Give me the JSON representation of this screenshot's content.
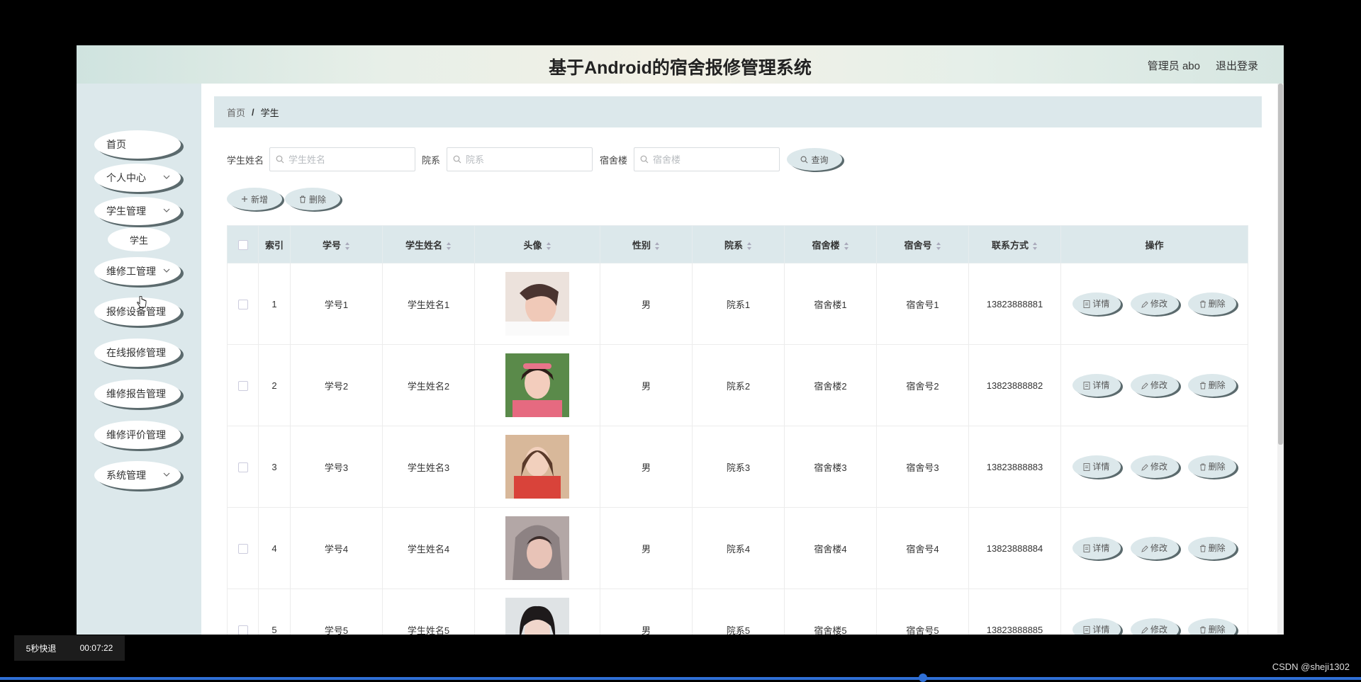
{
  "header": {
    "title": "基于Android的宿舍报修管理系统",
    "user": "管理员 abo",
    "logout": "退出登录"
  },
  "sidebar": {
    "items": [
      {
        "label": "首页"
      },
      {
        "label": "个人中心"
      },
      {
        "label": "学生管理"
      },
      {
        "label": "学生"
      },
      {
        "label": "维修工管理"
      },
      {
        "label": "报修设备管理"
      },
      {
        "label": "在线报修管理"
      },
      {
        "label": "维修报告管理"
      },
      {
        "label": "维修评价管理"
      },
      {
        "label": "系统管理"
      }
    ]
  },
  "breadcrumb": {
    "home": "首页",
    "separator": "/",
    "current": "学生"
  },
  "search": {
    "name_label": "学生姓名",
    "name_placeholder": "学生姓名",
    "dept_label": "院系",
    "dept_placeholder": "院系",
    "dorm_label": "宿舍楼",
    "dorm_placeholder": "宿舍楼",
    "query_button": "查询"
  },
  "toolbar": {
    "add": "新增",
    "delete": "删除"
  },
  "table": {
    "headers": [
      "索引",
      "学号",
      "学生姓名",
      "头像",
      "性别",
      "院系",
      "宿舍楼",
      "宿舍号",
      "联系方式",
      "操作"
    ],
    "rows": [
      {
        "index": "1",
        "id": "学号1",
        "name": "学生姓名1",
        "gender": "男",
        "dept": "院系1",
        "building": "宿舍楼1",
        "room": "宿舍号1",
        "phone": "13823888881"
      },
      {
        "index": "2",
        "id": "学号2",
        "name": "学生姓名2",
        "gender": "男",
        "dept": "院系2",
        "building": "宿舍楼2",
        "room": "宿舍号2",
        "phone": "13823888882"
      },
      {
        "index": "3",
        "id": "学号3",
        "name": "学生姓名3",
        "gender": "男",
        "dept": "院系3",
        "building": "宿舍楼3",
        "room": "宿舍号3",
        "phone": "13823888883"
      },
      {
        "index": "4",
        "id": "学号4",
        "name": "学生姓名4",
        "gender": "男",
        "dept": "院系4",
        "building": "宿舍楼4",
        "room": "宿舍号4",
        "phone": "13823888884"
      },
      {
        "index": "5",
        "id": "学号5",
        "name": "学生姓名5",
        "gender": "男",
        "dept": "院系5",
        "building": "宿舍楼5",
        "room": "宿舍号5",
        "phone": "13823888885"
      }
    ],
    "actions": {
      "detail": "详情",
      "edit": "修改",
      "delete": "删除"
    }
  },
  "player": {
    "rewind": "5秒快退",
    "time": "00:07:22"
  },
  "watermark": "CSDN @sheji1302",
  "colors": {
    "accent": "#dce8eb",
    "shadow": "#5b6a6d",
    "progress": "#2f6fd6"
  },
  "icons": [
    "chevron-down-icon",
    "search-icon",
    "plus-icon",
    "trash-icon",
    "document-icon",
    "edit-icon",
    "sort-icon"
  ]
}
